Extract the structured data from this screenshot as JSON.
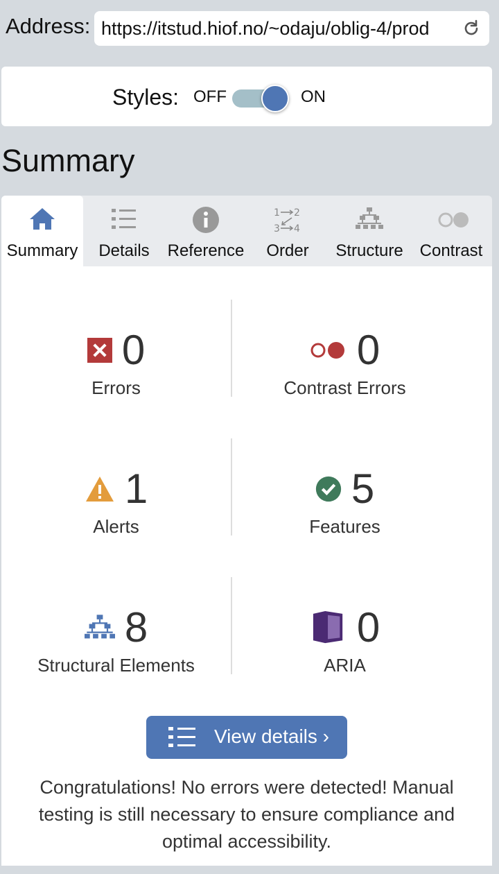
{
  "address": {
    "label": "Address:",
    "url": "https://itstud.hiof.no/~odaju/oblig-4/prod"
  },
  "styles": {
    "label": "Styles:",
    "off": "OFF",
    "on": "ON",
    "enabled": true
  },
  "heading": "Summary",
  "tabs": [
    {
      "label": "Summary",
      "icon": "home-icon",
      "active": true
    },
    {
      "label": "Details",
      "icon": "list-icon",
      "active": false
    },
    {
      "label": "Reference",
      "icon": "info-icon",
      "active": false
    },
    {
      "label": "Order",
      "icon": "order-icon",
      "active": false
    },
    {
      "label": "Structure",
      "icon": "structure-icon",
      "active": false
    },
    {
      "label": "Contrast",
      "icon": "contrast-icon",
      "active": false
    }
  ],
  "stats": {
    "errors": {
      "value": "0",
      "label": "Errors",
      "icon": "error-icon"
    },
    "contrast_errors": {
      "value": "0",
      "label": "Contrast Errors",
      "icon": "contrast-error-icon"
    },
    "alerts": {
      "value": "1",
      "label": "Alerts",
      "icon": "alert-icon"
    },
    "features": {
      "value": "5",
      "label": "Features",
      "icon": "feature-icon"
    },
    "structural": {
      "value": "8",
      "label": "Structural Elements",
      "icon": "structure-icon"
    },
    "aria": {
      "value": "0",
      "label": "ARIA",
      "icon": "aria-icon"
    }
  },
  "view_details": "View details ›",
  "message": "Congratulations! No errors were detected! Manual testing is still necessary to ensure compliance and optimal accessibility.",
  "colors": {
    "accent": "#4f76b4",
    "error": "#b33a3a",
    "alert": "#e39c3c",
    "feature": "#3f7a5b",
    "aria": "#4b2a73"
  }
}
